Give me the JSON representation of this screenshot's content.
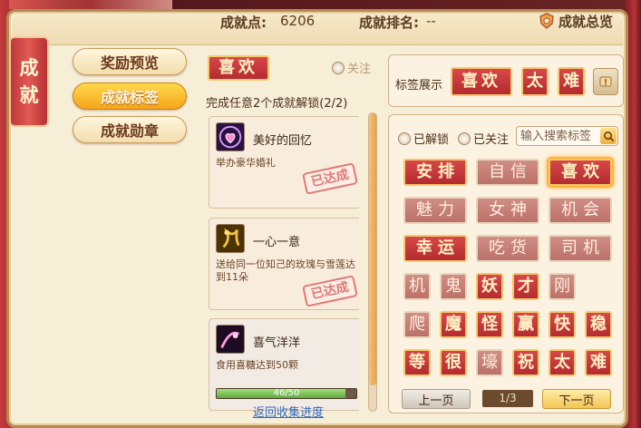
{
  "header": {
    "points_label": "成就点:",
    "points_value": "6206",
    "rank_label": "成就排名:",
    "rank_value": "--",
    "overview_label": "成就总览",
    "overview_icon": "shield-emblem-icon"
  },
  "title": [
    "成",
    "就"
  ],
  "nav": [
    {
      "label": "奖励预览",
      "active": false
    },
    {
      "label": "成就标签",
      "active": true
    },
    {
      "label": "成就勋章",
      "active": false
    }
  ],
  "middle": {
    "tag": "喜欢",
    "follow_label": "关注",
    "unlock_text": "完成任意2个成就解锁(2/2)",
    "achievements": [
      {
        "name": "美好的回忆",
        "desc": "举办豪华婚礼",
        "icon": "ring-heart-icon",
        "completed": true,
        "stamp": "已达成"
      },
      {
        "name": "一心一意",
        "desc": "送给同一位知己的玫瑰与雪莲达到11朵",
        "icon": "flower-bouquet-icon",
        "completed": true,
        "stamp": "已达成"
      },
      {
        "name": "喜气洋洋",
        "desc": "食用喜糖达到50颗",
        "icon": "candy-icon",
        "completed": false,
        "progress_text": "46/50",
        "progress": 0.92
      }
    ],
    "back_link": "返回收集进度"
  },
  "display": {
    "label": "标签展示",
    "tags": [
      "喜欢",
      "太",
      "难"
    ],
    "add_icon": "exclamation-scroll-icon"
  },
  "pool": {
    "filter_unlocked": "已解锁",
    "filter_followed": "已关注",
    "search_placeholder": "输入搜索标签",
    "search_icon": "search-icon",
    "rows": [
      [
        {
          "t": "安排",
          "on": true
        },
        {
          "t": "自信",
          "on": false
        },
        {
          "t": "喜欢",
          "on": true,
          "sel": true
        }
      ],
      [
        {
          "t": "魅力",
          "on": false
        },
        {
          "t": "女神",
          "on": false
        },
        {
          "t": "机会",
          "on": false
        }
      ],
      [
        {
          "t": "幸运",
          "on": true
        },
        {
          "t": "吃货",
          "on": false
        },
        {
          "t": "司机",
          "on": false
        }
      ],
      [
        {
          "t": "机智",
          "on": false
        },
        {
          "t": "鬼",
          "on": false
        },
        {
          "t": "妖",
          "on": true
        },
        {
          "t": "才",
          "on": true
        },
        {
          "t": "刚",
          "on": false
        }
      ],
      [
        {
          "t": "爬",
          "on": false
        },
        {
          "t": "魔",
          "on": true
        },
        {
          "t": "怪",
          "on": true
        },
        {
          "t": "赢",
          "on": true
        },
        {
          "t": "快",
          "on": true
        },
        {
          "t": "稳",
          "on": true
        }
      ],
      [
        {
          "t": "等",
          "on": true
        },
        {
          "t": "很",
          "on": true
        },
        {
          "t": "壕",
          "on": false
        },
        {
          "t": "祝",
          "on": true
        },
        {
          "t": "太",
          "on": true
        },
        {
          "t": "难",
          "on": true
        }
      ]
    ],
    "prev_label": "上一页",
    "next_label": "下一页",
    "page": "1/3"
  }
}
